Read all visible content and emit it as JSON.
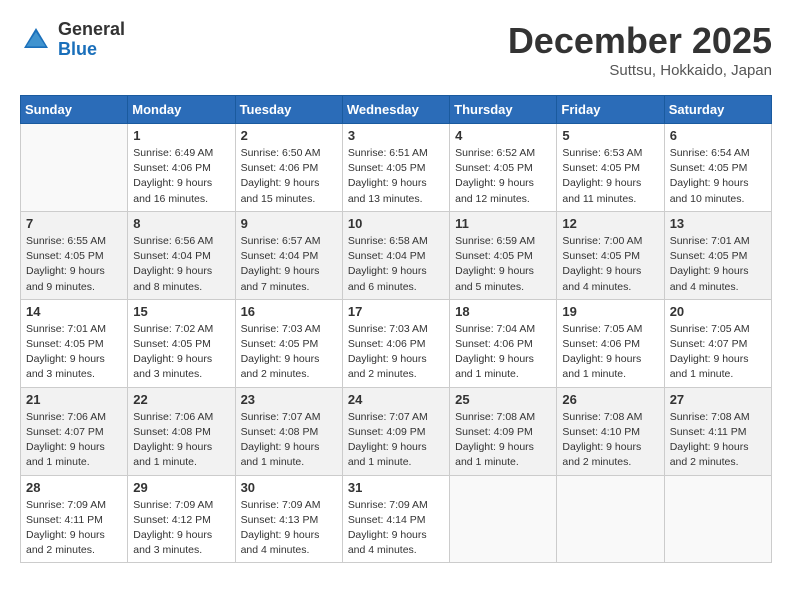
{
  "header": {
    "logo_general": "General",
    "logo_blue": "Blue",
    "month": "December 2025",
    "location": "Suttsu, Hokkaido, Japan"
  },
  "days_of_week": [
    "Sunday",
    "Monday",
    "Tuesday",
    "Wednesday",
    "Thursday",
    "Friday",
    "Saturday"
  ],
  "weeks": [
    [
      {
        "day": "",
        "info": ""
      },
      {
        "day": "1",
        "info": "Sunrise: 6:49 AM\nSunset: 4:06 PM\nDaylight: 9 hours\nand 16 minutes."
      },
      {
        "day": "2",
        "info": "Sunrise: 6:50 AM\nSunset: 4:06 PM\nDaylight: 9 hours\nand 15 minutes."
      },
      {
        "day": "3",
        "info": "Sunrise: 6:51 AM\nSunset: 4:05 PM\nDaylight: 9 hours\nand 13 minutes."
      },
      {
        "day": "4",
        "info": "Sunrise: 6:52 AM\nSunset: 4:05 PM\nDaylight: 9 hours\nand 12 minutes."
      },
      {
        "day": "5",
        "info": "Sunrise: 6:53 AM\nSunset: 4:05 PM\nDaylight: 9 hours\nand 11 minutes."
      },
      {
        "day": "6",
        "info": "Sunrise: 6:54 AM\nSunset: 4:05 PM\nDaylight: 9 hours\nand 10 minutes."
      }
    ],
    [
      {
        "day": "7",
        "info": "Sunrise: 6:55 AM\nSunset: 4:05 PM\nDaylight: 9 hours\nand 9 minutes."
      },
      {
        "day": "8",
        "info": "Sunrise: 6:56 AM\nSunset: 4:04 PM\nDaylight: 9 hours\nand 8 minutes."
      },
      {
        "day": "9",
        "info": "Sunrise: 6:57 AM\nSunset: 4:04 PM\nDaylight: 9 hours\nand 7 minutes."
      },
      {
        "day": "10",
        "info": "Sunrise: 6:58 AM\nSunset: 4:04 PM\nDaylight: 9 hours\nand 6 minutes."
      },
      {
        "day": "11",
        "info": "Sunrise: 6:59 AM\nSunset: 4:05 PM\nDaylight: 9 hours\nand 5 minutes."
      },
      {
        "day": "12",
        "info": "Sunrise: 7:00 AM\nSunset: 4:05 PM\nDaylight: 9 hours\nand 4 minutes."
      },
      {
        "day": "13",
        "info": "Sunrise: 7:01 AM\nSunset: 4:05 PM\nDaylight: 9 hours\nand 4 minutes."
      }
    ],
    [
      {
        "day": "14",
        "info": "Sunrise: 7:01 AM\nSunset: 4:05 PM\nDaylight: 9 hours\nand 3 minutes."
      },
      {
        "day": "15",
        "info": "Sunrise: 7:02 AM\nSunset: 4:05 PM\nDaylight: 9 hours\nand 3 minutes."
      },
      {
        "day": "16",
        "info": "Sunrise: 7:03 AM\nSunset: 4:05 PM\nDaylight: 9 hours\nand 2 minutes."
      },
      {
        "day": "17",
        "info": "Sunrise: 7:03 AM\nSunset: 4:06 PM\nDaylight: 9 hours\nand 2 minutes."
      },
      {
        "day": "18",
        "info": "Sunrise: 7:04 AM\nSunset: 4:06 PM\nDaylight: 9 hours\nand 1 minute."
      },
      {
        "day": "19",
        "info": "Sunrise: 7:05 AM\nSunset: 4:06 PM\nDaylight: 9 hours\nand 1 minute."
      },
      {
        "day": "20",
        "info": "Sunrise: 7:05 AM\nSunset: 4:07 PM\nDaylight: 9 hours\nand 1 minute."
      }
    ],
    [
      {
        "day": "21",
        "info": "Sunrise: 7:06 AM\nSunset: 4:07 PM\nDaylight: 9 hours\nand 1 minute."
      },
      {
        "day": "22",
        "info": "Sunrise: 7:06 AM\nSunset: 4:08 PM\nDaylight: 9 hours\nand 1 minute."
      },
      {
        "day": "23",
        "info": "Sunrise: 7:07 AM\nSunset: 4:08 PM\nDaylight: 9 hours\nand 1 minute."
      },
      {
        "day": "24",
        "info": "Sunrise: 7:07 AM\nSunset: 4:09 PM\nDaylight: 9 hours\nand 1 minute."
      },
      {
        "day": "25",
        "info": "Sunrise: 7:08 AM\nSunset: 4:09 PM\nDaylight: 9 hours\nand 1 minute."
      },
      {
        "day": "26",
        "info": "Sunrise: 7:08 AM\nSunset: 4:10 PM\nDaylight: 9 hours\nand 2 minutes."
      },
      {
        "day": "27",
        "info": "Sunrise: 7:08 AM\nSunset: 4:11 PM\nDaylight: 9 hours\nand 2 minutes."
      }
    ],
    [
      {
        "day": "28",
        "info": "Sunrise: 7:09 AM\nSunset: 4:11 PM\nDaylight: 9 hours\nand 2 minutes."
      },
      {
        "day": "29",
        "info": "Sunrise: 7:09 AM\nSunset: 4:12 PM\nDaylight: 9 hours\nand 3 minutes."
      },
      {
        "day": "30",
        "info": "Sunrise: 7:09 AM\nSunset: 4:13 PM\nDaylight: 9 hours\nand 4 minutes."
      },
      {
        "day": "31",
        "info": "Sunrise: 7:09 AM\nSunset: 4:14 PM\nDaylight: 9 hours\nand 4 minutes."
      },
      {
        "day": "",
        "info": ""
      },
      {
        "day": "",
        "info": ""
      },
      {
        "day": "",
        "info": ""
      }
    ]
  ]
}
